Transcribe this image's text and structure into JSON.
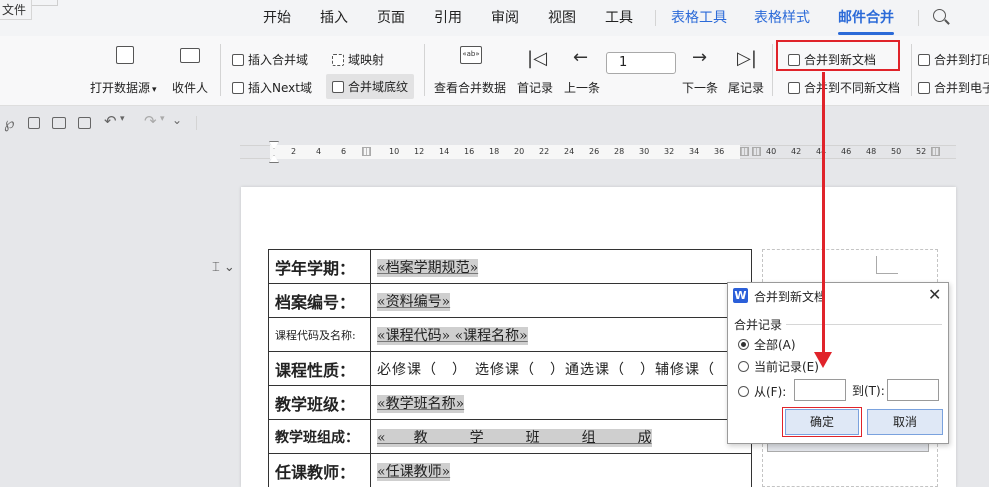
{
  "menu": {
    "file": "文件",
    "items": [
      {
        "label": "开始",
        "style": "normal"
      },
      {
        "label": "插入",
        "style": "normal"
      },
      {
        "label": "页面",
        "style": "normal"
      },
      {
        "label": "引用",
        "style": "normal"
      },
      {
        "label": "审阅",
        "style": "normal"
      },
      {
        "label": "视图",
        "style": "normal"
      },
      {
        "label": "工具",
        "style": "normal"
      },
      {
        "label": "表格工具",
        "style": "blue"
      },
      {
        "label": "表格样式",
        "style": "blue"
      },
      {
        "label": "邮件合并",
        "style": "active"
      }
    ],
    "search_icon": "search-icon"
  },
  "ribbon": {
    "open_datasource": "打开数据源",
    "recipients": "收件人",
    "insert_merge_field": "插入合并域",
    "field_mapping": "域映射",
    "insert_next": "插入Next域",
    "field_shading": "合并域底纹",
    "view_merged_data": "查看合并数据",
    "first_record": "首记录",
    "prev_record": "上一条",
    "record_number": "1",
    "next_record": "下一条",
    "last_record": "尾记录",
    "merge_to_new_doc": "合并到新文档",
    "merge_to_different_docs": "合并到不同新文档",
    "merge_to_printer": "合并到打印",
    "merge_to_email": "合并到电子"
  },
  "ruler": {
    "numbers": [
      "2",
      "4",
      "6",
      "10",
      "12",
      "14",
      "16",
      "18",
      "20",
      "22",
      "24",
      "26",
      "28",
      "30",
      "32",
      "34",
      "36",
      "40",
      "42",
      "44",
      "46",
      "48",
      "50",
      "52"
    ]
  },
  "document": {
    "rows": [
      {
        "label": "学年学期：",
        "value": "«档案学期规范»",
        "type": "field"
      },
      {
        "label": "档案编号：",
        "value": "«资料编号»",
        "type": "field"
      },
      {
        "label": "课程代码及名称:",
        "value": "«课程代码» «课程名称»",
        "type": "field"
      },
      {
        "label": "课程性质：",
        "value": "必修课（　）　选修课（　）通选课（　）辅修课（　）",
        "type": "normal"
      },
      {
        "label": "教学班级：",
        "value": "«教学班名称»",
        "type": "field"
      },
      {
        "label": "教学班组成：",
        "value": "«　　教　　　学　　　班　　　组　　　成",
        "type": "field"
      },
      {
        "label": "任课教师：",
        "value": "«任课教师»",
        "type": "field"
      }
    ]
  },
  "dialog": {
    "title": "合并到新文档",
    "group_label": "合并记录",
    "option_all": "全部(A)",
    "option_current": "当前记录(E)",
    "option_from": "从(F):",
    "to_label": "到(T):",
    "ok": "确定",
    "cancel": "取消"
  },
  "colors": {
    "accent": "#2b6ad8",
    "highlight": "#e0232a"
  }
}
